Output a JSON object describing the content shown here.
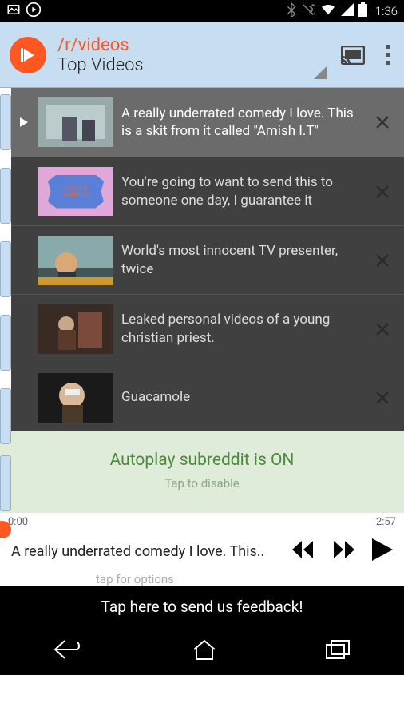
{
  "status": {
    "time": "1:36"
  },
  "header": {
    "title": "/r/videos",
    "subtitle": "Top Videos"
  },
  "videos": [
    {
      "title": "A really underrated comedy I love. This is a skit from it called \"Amish I.T\"",
      "active": true
    },
    {
      "title": "You're going to want to send this to someone one day, I guarantee it",
      "active": false
    },
    {
      "title": "World's most innocent TV presenter, twice",
      "active": false
    },
    {
      "title": "Leaked personal videos of a young christian priest.",
      "active": false
    },
    {
      "title": "Guacamole",
      "active": false
    }
  ],
  "autoplay": {
    "title": "Autoplay subreddit is ON",
    "sub": "Tap to disable"
  },
  "player": {
    "start": "0:00",
    "end": "2:57",
    "now_playing": "A really underrated comedy I love. This..",
    "options_hint": "tap for options"
  },
  "feedback": {
    "label": "Tap here to send us feedback!"
  }
}
